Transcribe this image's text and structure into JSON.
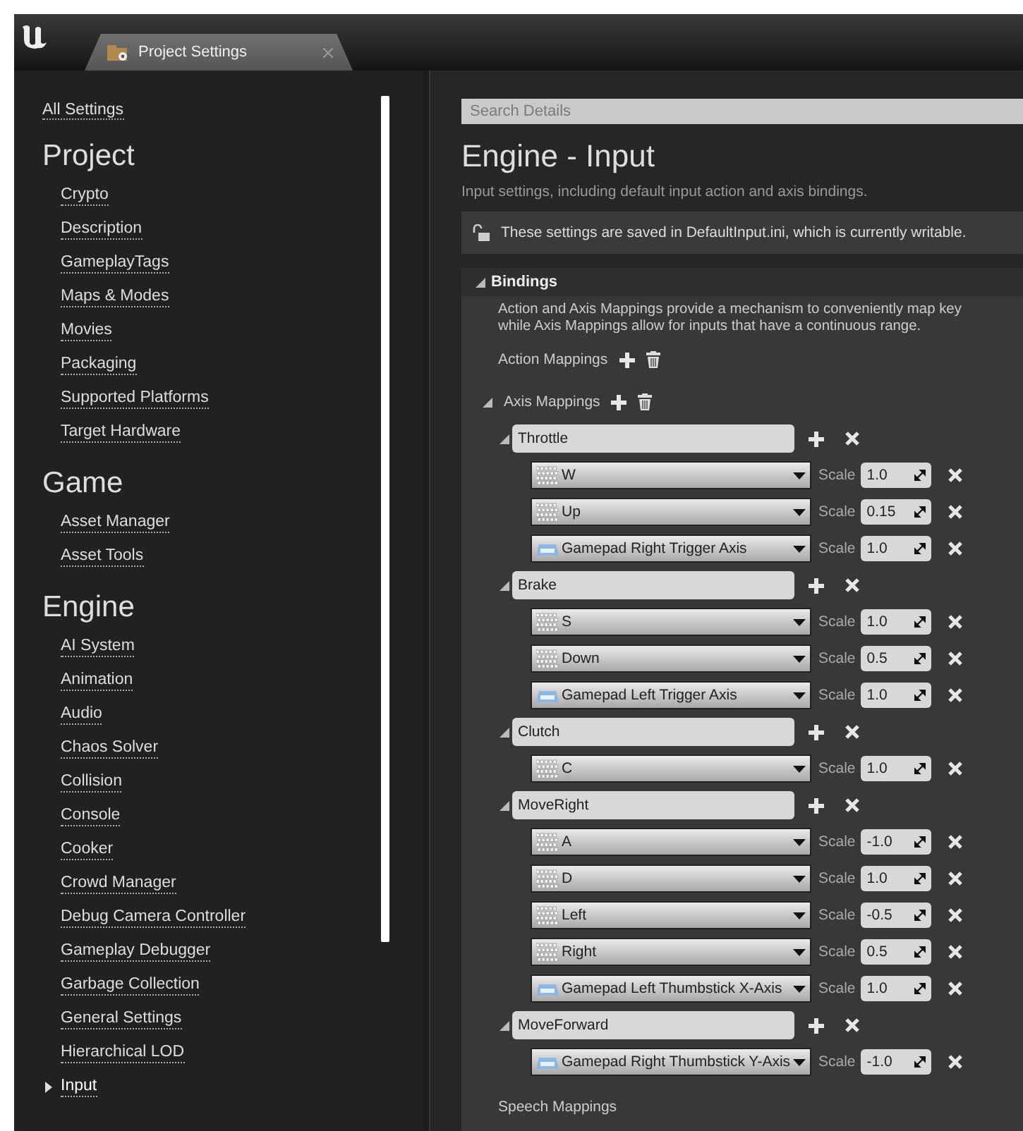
{
  "window": {
    "tab_title": "Project Settings"
  },
  "sidebar": {
    "all_settings": "All Settings",
    "sections": [
      {
        "title": "Project",
        "items": [
          {
            "label": "Crypto",
            "selected": false
          },
          {
            "label": "Description",
            "selected": false
          },
          {
            "label": "GameplayTags",
            "selected": false
          },
          {
            "label": "Maps & Modes",
            "selected": false
          },
          {
            "label": "Movies",
            "selected": false
          },
          {
            "label": "Packaging",
            "selected": false
          },
          {
            "label": "Supported Platforms",
            "selected": false
          },
          {
            "label": "Target Hardware",
            "selected": false
          }
        ]
      },
      {
        "title": "Game",
        "items": [
          {
            "label": "Asset Manager",
            "selected": false
          },
          {
            "label": "Asset Tools",
            "selected": false
          }
        ]
      },
      {
        "title": "Engine",
        "items": [
          {
            "label": "AI System",
            "selected": false
          },
          {
            "label": "Animation",
            "selected": false
          },
          {
            "label": "Audio",
            "selected": false
          },
          {
            "label": "Chaos Solver",
            "selected": false
          },
          {
            "label": "Collision",
            "selected": false
          },
          {
            "label": "Console",
            "selected": false
          },
          {
            "label": "Cooker",
            "selected": false
          },
          {
            "label": "Crowd Manager",
            "selected": false
          },
          {
            "label": "Debug Camera Controller",
            "selected": false
          },
          {
            "label": "Gameplay Debugger",
            "selected": false
          },
          {
            "label": "Garbage Collection",
            "selected": false
          },
          {
            "label": "General Settings",
            "selected": false
          },
          {
            "label": "Hierarchical LOD",
            "selected": false
          },
          {
            "label": "Input",
            "selected": true
          }
        ]
      }
    ]
  },
  "details": {
    "search": {
      "placeholder": "Search Details"
    },
    "title": "Engine - Input",
    "description": "Input settings, including default input action and axis bindings.",
    "notice": "These settings are saved in DefaultInput.ini, which is currently writable.",
    "bindings": {
      "title": "Bindings",
      "expanded": true,
      "description_lines": [
        "Action and Axis Mappings provide a mechanism to conveniently map key",
        "while Axis Mappings allow for inputs that have a continuous range."
      ],
      "action_mappings": {
        "label": "Action Mappings"
      },
      "axis_mappings": {
        "label": "Axis Mappings",
        "expanded": true,
        "mappings": [
          {
            "name": "Throttle",
            "expanded": true,
            "keys": [
              {
                "kind": "keyboard",
                "key": "W",
                "scale_label": "Scale",
                "scale": "1.0"
              },
              {
                "kind": "keyboard",
                "key": "Up",
                "scale_label": "Scale",
                "scale": "0.15"
              },
              {
                "kind": "gamepad",
                "key": "Gamepad Right Trigger Axis",
                "scale_label": "Scale",
                "scale": "1.0"
              }
            ]
          },
          {
            "name": "Brake",
            "expanded": true,
            "keys": [
              {
                "kind": "keyboard",
                "key": "S",
                "scale_label": "Scale",
                "scale": "1.0"
              },
              {
                "kind": "keyboard",
                "key": "Down",
                "scale_label": "Scale",
                "scale": "0.5"
              },
              {
                "kind": "gamepad",
                "key": "Gamepad Left Trigger Axis",
                "scale_label": "Scale",
                "scale": "1.0"
              }
            ]
          },
          {
            "name": "Clutch",
            "expanded": true,
            "keys": [
              {
                "kind": "keyboard",
                "key": "C",
                "scale_label": "Scale",
                "scale": "1.0"
              }
            ]
          },
          {
            "name": "MoveRight",
            "expanded": true,
            "keys": [
              {
                "kind": "keyboard",
                "key": "A",
                "scale_label": "Scale",
                "scale": "-1.0"
              },
              {
                "kind": "keyboard",
                "key": "D",
                "scale_label": "Scale",
                "scale": "1.0"
              },
              {
                "kind": "keyboard",
                "key": "Left",
                "scale_label": "Scale",
                "scale": "-0.5"
              },
              {
                "kind": "keyboard",
                "key": "Right",
                "scale_label": "Scale",
                "scale": "0.5"
              },
              {
                "kind": "gamepad",
                "key": "Gamepad Left Thumbstick X-Axis",
                "scale_label": "Scale",
                "scale": "1.0"
              }
            ]
          },
          {
            "name": "MoveForward",
            "expanded": true,
            "keys": [
              {
                "kind": "gamepad",
                "key": "Gamepad Right Thumbstick Y-Axis",
                "scale_label": "Scale",
                "scale": "-1.0"
              }
            ]
          }
        ]
      },
      "speech_mappings": {
        "label": "Speech Mappings"
      }
    }
  }
}
